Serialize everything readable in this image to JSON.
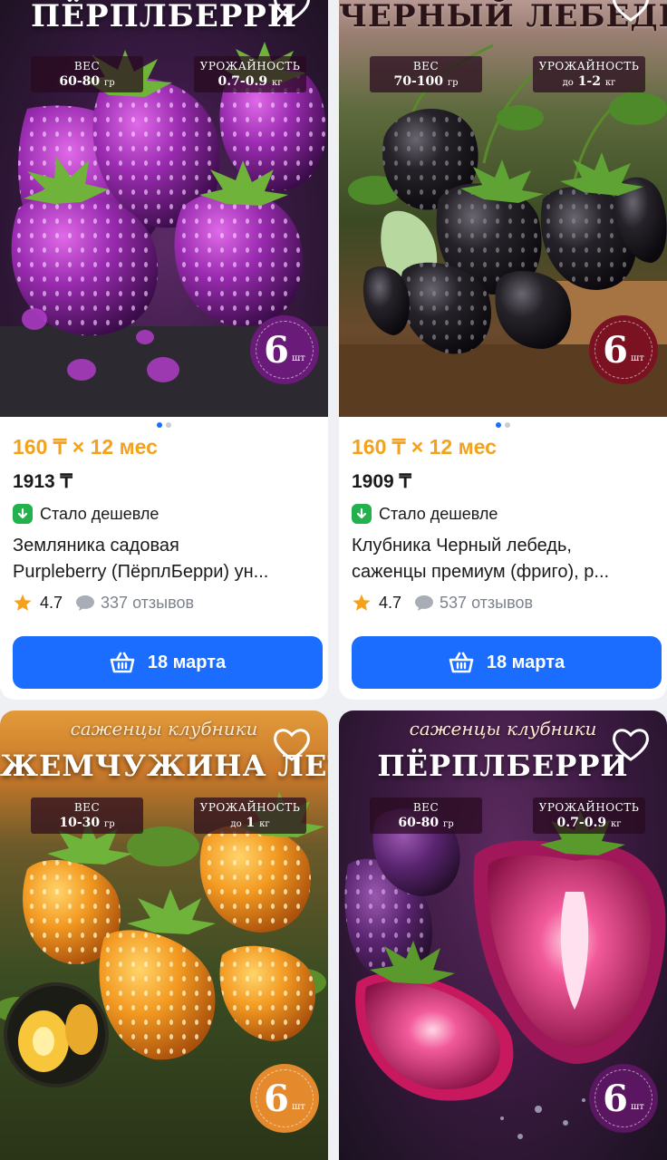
{
  "products": [
    {
      "subtitle": "",
      "title": "ПЁРПЛБЕРРИ",
      "weight_label": "ВЕС",
      "weight_value": "60-80",
      "weight_unit": "гр",
      "yield_label": "УРОЖАЙНОСТЬ",
      "yield_prefix": "",
      "yield_value": "0.7-0.9",
      "yield_unit": "кг",
      "stamp_number": "6",
      "stamp_unit": "шт",
      "installment": "160 ₸ × 12 мес",
      "price": "1913 ₸",
      "cheaper": "Стало дешевле",
      "desc_line1": "Земляника садовая",
      "desc_line2": "Purpleberry (ПёрплБерри) ун...",
      "rating": "4.7",
      "reviews": "337 отзывов",
      "button": "18 марта"
    },
    {
      "subtitle": "",
      "title": "ЧЕРНЫЙ ЛЕБЕДЬ",
      "weight_label": "ВЕС",
      "weight_value": "70-100",
      "weight_unit": "гр",
      "yield_label": "УРОЖАЙНОСТЬ",
      "yield_prefix": "до",
      "yield_value": "1-2",
      "yield_unit": "кг",
      "stamp_number": "6",
      "stamp_unit": "шт",
      "installment": "160 ₸ × 12 мес",
      "price": "1909 ₸",
      "cheaper": "Стало дешевле",
      "desc_line1": "Клубника Черный лебедь,",
      "desc_line2": "саженцы премиум (фриго), р...",
      "rating": "4.7",
      "reviews": "537 отзывов",
      "button": "18 марта"
    },
    {
      "subtitle": "саженцы клубники",
      "title": "ЖЕМЧУЖИНА ЛЕТА",
      "weight_label": "ВЕС",
      "weight_value": "10-30",
      "weight_unit": "гр",
      "yield_label": "УРОЖАЙНОСТЬ",
      "yield_prefix": "до",
      "yield_value": "1",
      "yield_unit": "кг",
      "stamp_number": "6",
      "stamp_unit": "шт"
    },
    {
      "subtitle": "саженцы клубники",
      "title": "ПЁРПЛБЕРРИ",
      "weight_label": "ВЕС",
      "weight_value": "60-80",
      "weight_unit": "гр",
      "yield_label": "УРОЖАЙНОСТЬ",
      "yield_prefix": "",
      "yield_value": "0.7-0.9",
      "yield_unit": "кг",
      "stamp_number": "6",
      "stamp_unit": "шт"
    }
  ],
  "colors": {
    "accent": "#1a6dff",
    "installment": "#f4a21b",
    "cheaper_badge": "#22b14c",
    "star": "#f4a21b",
    "purple_stamp": "#6a1a78",
    "black_stamp": "#7a1222",
    "orange_stamp": "#e58a2c",
    "purple2_stamp": "#5a1660"
  },
  "icons": {
    "favorite": "heart-icon",
    "cheaper": "price-down-icon",
    "rating": "star-icon",
    "reviews": "chat-bubble-icon",
    "cart": "basket-icon"
  }
}
